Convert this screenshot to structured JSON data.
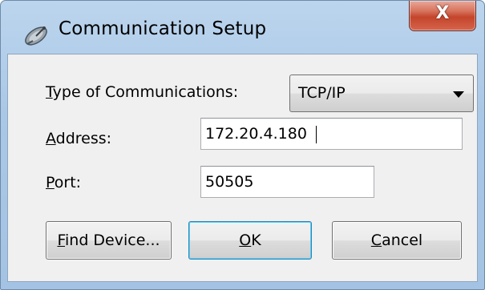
{
  "window": {
    "title": "Communication Setup",
    "close_glyph": "X",
    "icon": "satellite-dish-icon"
  },
  "form": {
    "type_label_first": "T",
    "type_label_rest": "ype of Communications:",
    "type_value": "TCP/IP",
    "address_label_first": "A",
    "address_label_rest": "ddress:",
    "address_value": "172.20.4.180",
    "port_label_first": "P",
    "port_label_rest": "ort:",
    "port_value": "50505"
  },
  "buttons": {
    "find_first": "F",
    "find_rest": "ind Device...",
    "ok_first": "O",
    "ok_rest": "K",
    "cancel_first": "C",
    "cancel_rest": "ancel"
  },
  "colors": {
    "frame": "#a9c7e6",
    "close_button": "#c4452b",
    "dialog_background": "#f0f0f0"
  }
}
